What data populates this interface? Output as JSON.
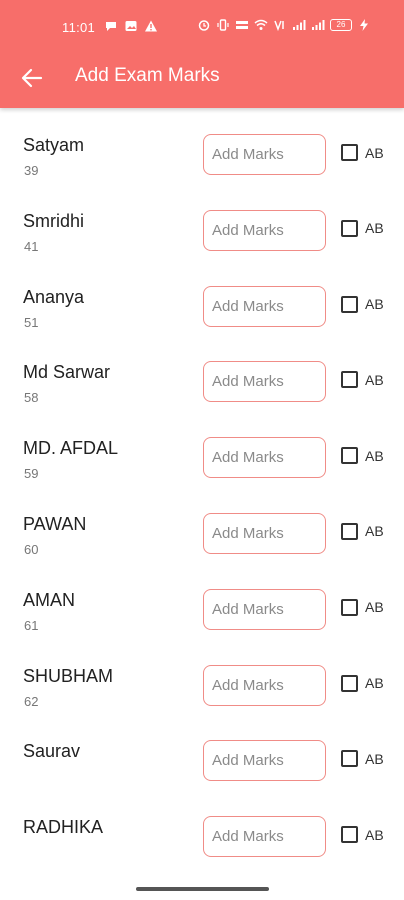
{
  "status_bar": {
    "time": "11:01",
    "battery": "26"
  },
  "header": {
    "title": "Add Exam Marks"
  },
  "students": [
    {
      "name": "Satyam",
      "roll": "39"
    },
    {
      "name": "Smridhi",
      "roll": "41"
    },
    {
      "name": "Ananya",
      "roll": "51"
    },
    {
      "name": "Md Sarwar",
      "roll": "58"
    },
    {
      "name": "MD. AFDAL",
      "roll": "59"
    },
    {
      "name": "PAWAN",
      "roll": "60"
    },
    {
      "name": "AMAN",
      "roll": "61"
    },
    {
      "name": "SHUBHAM",
      "roll": "62"
    },
    {
      "name": "Saurav",
      "roll": ""
    },
    {
      "name": "RADHIKA",
      "roll": ""
    }
  ],
  "marks_placeholder": "Add Marks",
  "absent_label": "AB",
  "colors": {
    "app_bar": "#f76e6a",
    "input_border": "#f08c87"
  }
}
